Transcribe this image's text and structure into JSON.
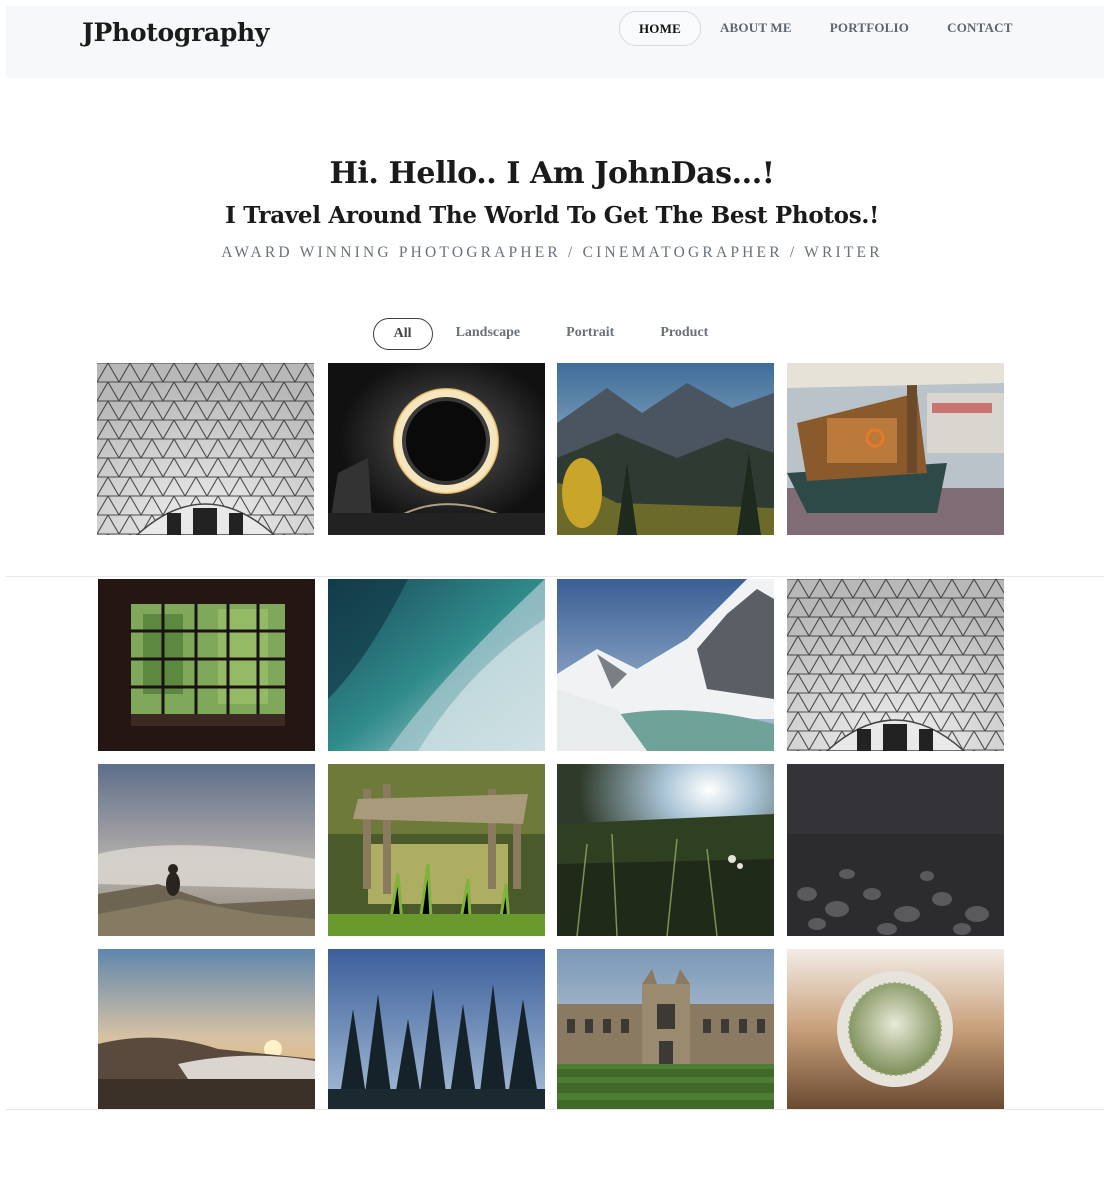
{
  "brand": "JPhotography",
  "nav": [
    {
      "label": "HOME",
      "active": true
    },
    {
      "label": "ABOUT ME",
      "active": false
    },
    {
      "label": "PORTFOLIO",
      "active": false
    },
    {
      "label": "CONTACT",
      "active": false
    }
  ],
  "hero": {
    "title": "Hi. Hello.. I Am JohnDas...!",
    "subtitle": "I Travel Around The World To Get The Best Photos.!",
    "tagline": "AWARD WINNING PHOTOGRAPHER / CINEMATOGRAPHER / WRITER"
  },
  "filters": [
    {
      "label": "All",
      "active": true
    },
    {
      "label": "Landscape",
      "active": false
    },
    {
      "label": "Portrait",
      "active": false
    },
    {
      "label": "Product",
      "active": false
    }
  ],
  "gallery": [
    "glass-dome-roof-photo",
    "steel-wool-fire-ring-photo",
    "mountain-valley-photo",
    "harbor-boats-photo",
    "forest-window-photo",
    "ocean-wave-photo",
    "snowy-mountain-lake-photo",
    "glass-dome-roof-photo",
    "hiker-misty-cliff-photo",
    "wooden-pier-pond-photo",
    "meadow-sunlight-photo",
    "dark-pebbles-photo",
    "sunrise-clouds-photo",
    "pine-forest-photo",
    "college-building-photo",
    "cactus-pot-photo"
  ]
}
